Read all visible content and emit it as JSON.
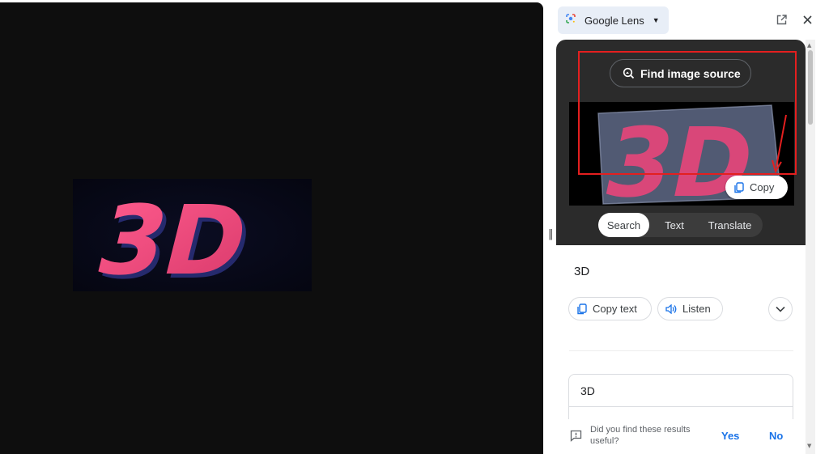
{
  "viewer": {
    "image_text": "3D",
    "divider_glyph": "‖"
  },
  "panel": {
    "header": {
      "title": "Google Lens",
      "icons": [
        "google-lens-icon",
        "dropdown-caret-icon",
        "open-in-new-tab-icon",
        "close-icon"
      ]
    },
    "find_source_label": "Find image source",
    "crop_text": "3D",
    "copy_button_label": "Copy",
    "modes": [
      {
        "label": "Search",
        "active": true
      },
      {
        "label": "Text",
        "active": false
      },
      {
        "label": "Translate",
        "active": false
      }
    ],
    "result": {
      "detected_text": "3D",
      "copy_text_label": "Copy text",
      "listen_label": "Listen",
      "text_field_value": "3D"
    },
    "feedback": {
      "question": "Did you find these results useful?",
      "yes_label": "Yes",
      "no_label": "No"
    }
  },
  "colors": {
    "annotation_red": "#e41f1f",
    "link_blue": "#1a73e8",
    "text_3d_pink": "#e8457a",
    "viewer_bg": "#0e0e0e",
    "lens_area_bg": "#2b2b2b"
  }
}
